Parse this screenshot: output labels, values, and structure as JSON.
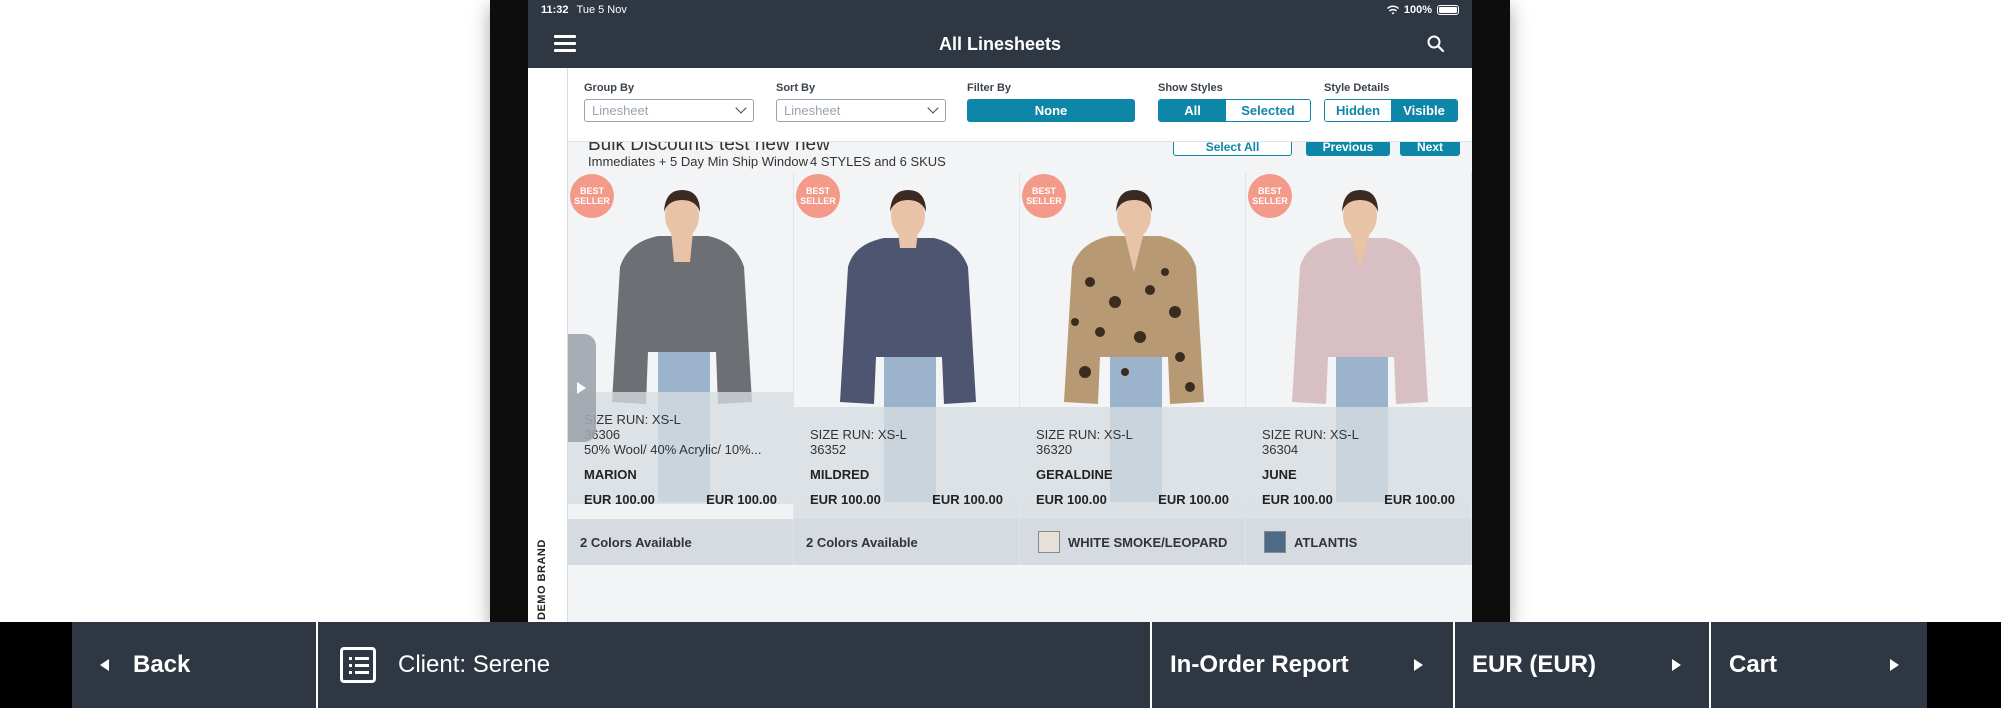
{
  "status_bar": {
    "time": "11:32",
    "date": "Tue 5 Nov",
    "battery": "100%"
  },
  "nav": {
    "title": "All Linesheets"
  },
  "filters": {
    "group_by_label": "Group By",
    "group_by_value": "Linesheet",
    "sort_by_label": "Sort By",
    "sort_by_value": "Linesheet",
    "filter_by_label": "Filter By",
    "filter_by_value": "None",
    "show_styles_label": "Show Styles",
    "show_styles_options": [
      "All",
      "Selected"
    ],
    "style_details_label": "Style Details",
    "style_details_options": [
      "Hidden",
      "Visible"
    ]
  },
  "section": {
    "title": "Bulk Discounts test new new",
    "subtitle": "Immediates + 5 Day Min Ship Window",
    "count": "4 STYLES and 6 SKUS",
    "select_all": "Select All",
    "previous": "Previous",
    "next": "Next"
  },
  "brand_label": "DEMO BRAND",
  "products": [
    {
      "badge": "BEST SELLER",
      "size_run": "SIZE RUN: XS-L",
      "style": "36306",
      "material": "50% Wool/ 40% Acrylic/ 10%...",
      "name": "MARION",
      "price_wholesale": "EUR 100.00",
      "price_retail": "EUR 100.00",
      "colors": "2 Colors Available",
      "swatch_color": ""
    },
    {
      "badge": "BEST SELLER",
      "size_run": "SIZE RUN: XS-L",
      "style": "36352",
      "material": "",
      "name": "MILDRED",
      "price_wholesale": "EUR 100.00",
      "price_retail": "EUR 100.00",
      "colors": "2 Colors Available",
      "swatch_color": ""
    },
    {
      "badge": "BEST SELLER",
      "size_run": "SIZE RUN: XS-L",
      "style": "36320",
      "material": "",
      "name": "GERALDINE",
      "price_wholesale": "EUR 100.00",
      "price_retail": "EUR 100.00",
      "colors": "WHITE SMOKE/LEOPARD",
      "swatch_color": "#e6e0d8"
    },
    {
      "badge": "BEST SELLER",
      "size_run": "SIZE RUN: XS-L",
      "style": "36304",
      "material": "",
      "name": "JUNE",
      "price_wholesale": "EUR 100.00",
      "price_retail": "EUR 100.00",
      "colors": "ATLANTIS",
      "swatch_color": "#4d6a86"
    }
  ],
  "toolbar": {
    "back": "Back",
    "client": "Client: Serene",
    "report": "In-Order Report",
    "currency": "EUR (EUR)",
    "cart": "Cart"
  },
  "colors": {
    "nav_bg": "#2e3742",
    "accent": "#0e86a8",
    "badge": "#f39a8a"
  }
}
